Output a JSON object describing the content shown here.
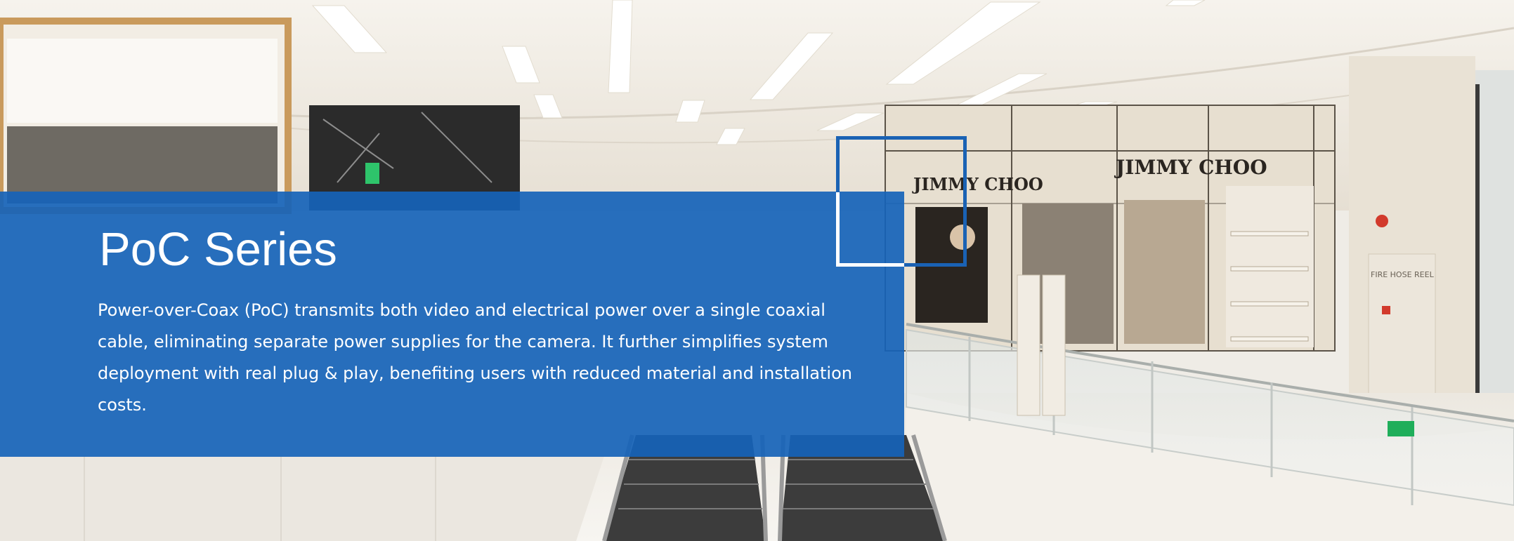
{
  "banner": {
    "title": "PoC Series",
    "description": "Power-over-Coax (PoC) transmits both video and electrical power over a single coaxial cable, eliminating separate power supplies for the camera. It further simplifies system deployment with real plug & play, benefiting users with reduced material and installation costs."
  },
  "background": {
    "scene": "shopping mall interior with escalator",
    "store_sign": "JIMMY CHOO",
    "store_sign_small": "JIMMY CHOO",
    "wall_label": "FIRE HOSE REEL"
  },
  "colors": {
    "overlay_blue": "#1663b8",
    "frame_blue": "#1a62b4",
    "text": "#ffffff"
  }
}
